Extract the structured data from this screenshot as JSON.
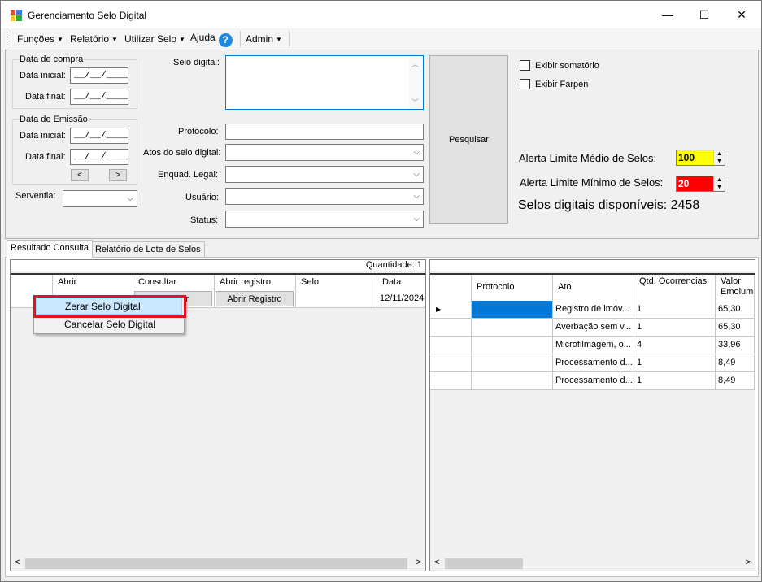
{
  "window": {
    "title": "Gerenciamento Selo Digital",
    "minimize": "—",
    "maximize": "☐",
    "close": "✕"
  },
  "menu": {
    "items": [
      "Funções",
      "Relatório",
      "Utilizar Selo",
      "Ajuda",
      "Admin"
    ],
    "help_glyph": "?"
  },
  "filters": {
    "data_compra": {
      "title": "Data de compra",
      "inicial_label": "Data inicial:",
      "final_label": "Data final:",
      "inicial_value": "__/__/____",
      "final_value": "__/__/____"
    },
    "data_emissao": {
      "title": "Data de Emissão",
      "inicial_label": "Data inicial:",
      "final_label": "Data final:",
      "inicial_value": "__/__/____",
      "final_value": "__/__/____",
      "prev": "<",
      "next": ">"
    },
    "serventia_label": "Serventia:",
    "selo_digital_label": "Selo digital:",
    "protocolo_label": "Protocolo:",
    "atos_label": "Atos do selo digital:",
    "enquad_label": "Enquad. Legal:",
    "usuario_label": "Usuário:",
    "status_label": "Status:",
    "pesquisar": "Pesquisar"
  },
  "options": {
    "exibir_somatorio": "Exibir somatório",
    "exibir_farpen": "Exibir Farpen"
  },
  "alerts": {
    "medio_label": "Alerta Limite Médio de Selos:",
    "medio_value": "100",
    "medio_color": "#ffff00",
    "minimo_label": "Alerta Limite Mínimo de Selos:",
    "minimo_value": "20",
    "minimo_color": "#ff0000",
    "disponiveis": "Selos digitais disponíveis: 2458"
  },
  "tabs": [
    "Resultado Consulta",
    "Relatório de Lote de Selos"
  ],
  "left_grid": {
    "quantidade": "Quantidade: 1",
    "headers": [
      "Abrir",
      "Consultar",
      "Abrir registro",
      "Selo",
      "Data"
    ],
    "row": {
      "consultar": "ar",
      "abrir_registro": "Abrir Registro",
      "selo": "",
      "data": "12/11/2024"
    }
  },
  "right_grid": {
    "headers": [
      "Protocolo",
      "Ato",
      "Qtd. Ocorrencias",
      "Valor Emolume"
    ],
    "rows": [
      {
        "protocolo": "",
        "ato": "Registro de imóv...",
        "qtd": "1",
        "valor": "65,30"
      },
      {
        "protocolo": "",
        "ato": "Averbação sem v...",
        "qtd": "1",
        "valor": "65,30"
      },
      {
        "protocolo": "",
        "ato": "Microfilmagem, o...",
        "qtd": "4",
        "valor": "33,96"
      },
      {
        "protocolo": "",
        "ato": "Processamento d...",
        "qtd": "1",
        "valor": "8,49"
      },
      {
        "protocolo": "",
        "ato": "Processamento d...",
        "qtd": "1",
        "valor": "8,49"
      }
    ],
    "selected_color": "#0078d7"
  },
  "context_menu": {
    "items": [
      "Zerar Selo Digital",
      "Cancelar Selo Digital"
    ],
    "highlight_color": "#e81123"
  },
  "scroll": {
    "left": "<",
    "right": ">"
  }
}
